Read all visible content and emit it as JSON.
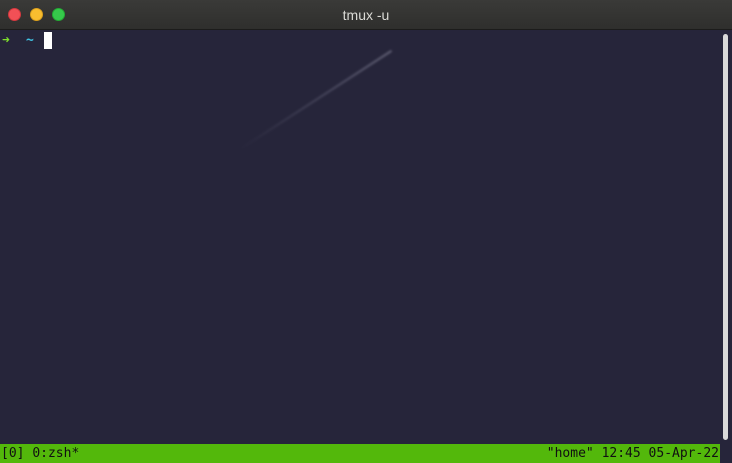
{
  "window": {
    "title": "tmux -u"
  },
  "prompt": {
    "arrow": "➜",
    "directory": "~"
  },
  "statusbar": {
    "session": "[0]",
    "window": "0:zsh*",
    "pane_title": "\"home\"",
    "time": "12:45",
    "date": "05-Apr-22"
  },
  "colors": {
    "terminal_bg": "#26253a",
    "status_bg": "#53b80b",
    "prompt_arrow": "#7ee02c",
    "prompt_dir": "#3fc0e0"
  }
}
